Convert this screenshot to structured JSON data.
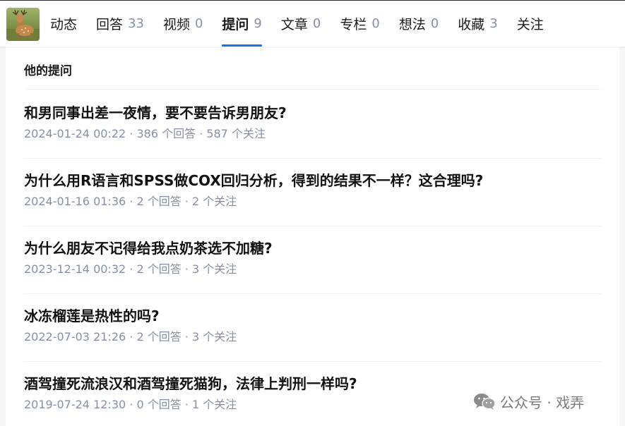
{
  "tabs": [
    {
      "label": "动态",
      "count": ""
    },
    {
      "label": "回答",
      "count": "33"
    },
    {
      "label": "视频",
      "count": "0"
    },
    {
      "label": "提问",
      "count": "9",
      "active": true
    },
    {
      "label": "文章",
      "count": "0"
    },
    {
      "label": "专栏",
      "count": "0"
    },
    {
      "label": "想法",
      "count": "0"
    },
    {
      "label": "收藏",
      "count": "3"
    },
    {
      "label": "关注",
      "count": ""
    }
  ],
  "section": {
    "title": "他的提问"
  },
  "questions": [
    {
      "title": "和男同事出差一夜情，要不要告诉男朋友?",
      "meta": "2024-01-24 00:22 · 386 个回答 · 587 个关注"
    },
    {
      "title": "为什么用R语言和SPSS做COX回归分析，得到的结果不一样？这合理吗?",
      "meta": "2024-01-16 01:36 · 2 个回答 · 2 个关注"
    },
    {
      "title": "为什么朋友不记得给我点奶茶选不加糖?",
      "meta": "2023-12-14 00:32 · 2 个回答 · 3 个关注"
    },
    {
      "title": "冰冻榴莲是热性的吗?",
      "meta": "2022-07-03 21:26 · 2 个回答 · 3 个关注"
    },
    {
      "title": "酒驾撞死流浪汉和酒驾撞死猫狗，法律上判刑一样吗?",
      "meta": "2019-07-24 12:30 · 0 个回答 · 1 个关注"
    }
  ],
  "watermark": {
    "text": "公众号 · 戏弄",
    "icon": "wechat-icon"
  },
  "colors": {
    "accent": "#1772f6",
    "meta": "#8590a6",
    "title": "#121212"
  }
}
